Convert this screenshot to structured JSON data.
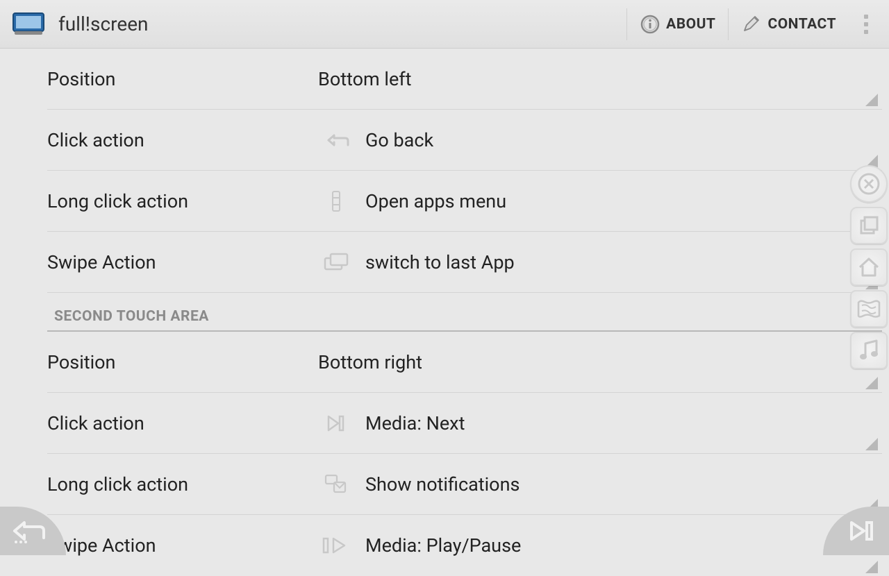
{
  "header": {
    "title": "full!screen",
    "about": "ABOUT",
    "contact": "CONTACT"
  },
  "rows": [
    {
      "label": "Position",
      "value": "Bottom left",
      "icon": null
    },
    {
      "label": "Click action",
      "value": "Go back",
      "icon": "back"
    },
    {
      "label": "Long click action",
      "value": "Open apps menu",
      "icon": "apps"
    },
    {
      "label": "Swipe Action",
      "value": "switch to last App",
      "icon": "switch"
    }
  ],
  "section2": "SECOND TOUCH AREA",
  "rows2": [
    {
      "label": "Position",
      "value": "Bottom right",
      "icon": null
    },
    {
      "label": "Click action",
      "value": "Media: Next",
      "icon": "next"
    },
    {
      "label": "Long click action",
      "value": "Show notifications",
      "icon": "notif"
    },
    {
      "label": "Swipe Action",
      "value": "Media: Play/Pause",
      "icon": "playpause"
    }
  ]
}
